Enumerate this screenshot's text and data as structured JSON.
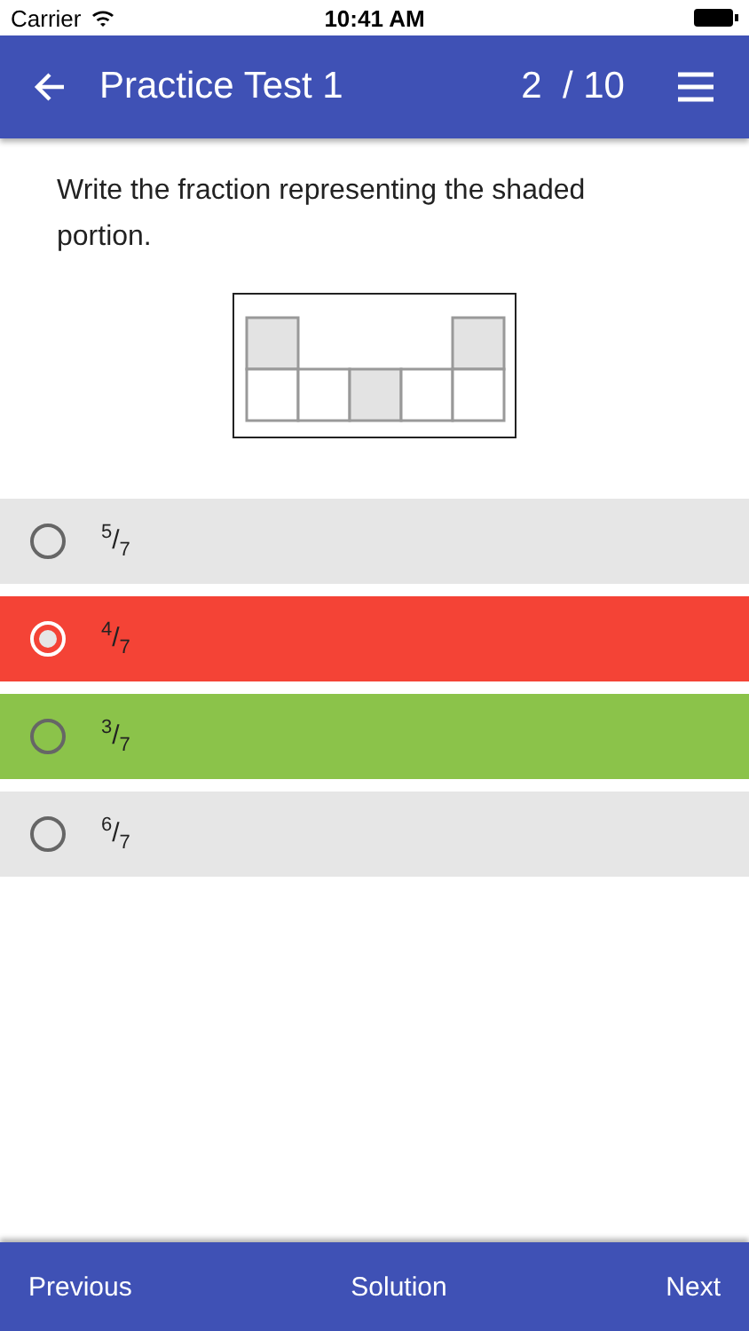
{
  "status_bar": {
    "carrier": "Carrier",
    "time": "10:41 AM"
  },
  "header": {
    "title": "Practice Test 1",
    "progress": "2  / 10"
  },
  "question": "Write the fraction representing the shaded portion.",
  "options": [
    {
      "label": "$^{5}$/$_{7}$",
      "selected": false,
      "kind": "neutral"
    },
    {
      "label": "$^{4}$/$_{7}$",
      "selected": true,
      "kind": "wrong"
    },
    {
      "label": "$^{3}$/$_{7}$",
      "selected": false,
      "kind": "correct"
    },
    {
      "label": "$^{6}$/$_{7}$",
      "selected": false,
      "kind": "neutral"
    }
  ],
  "footer": {
    "previous": "Previous",
    "solution": "Solution",
    "next": "Next"
  }
}
